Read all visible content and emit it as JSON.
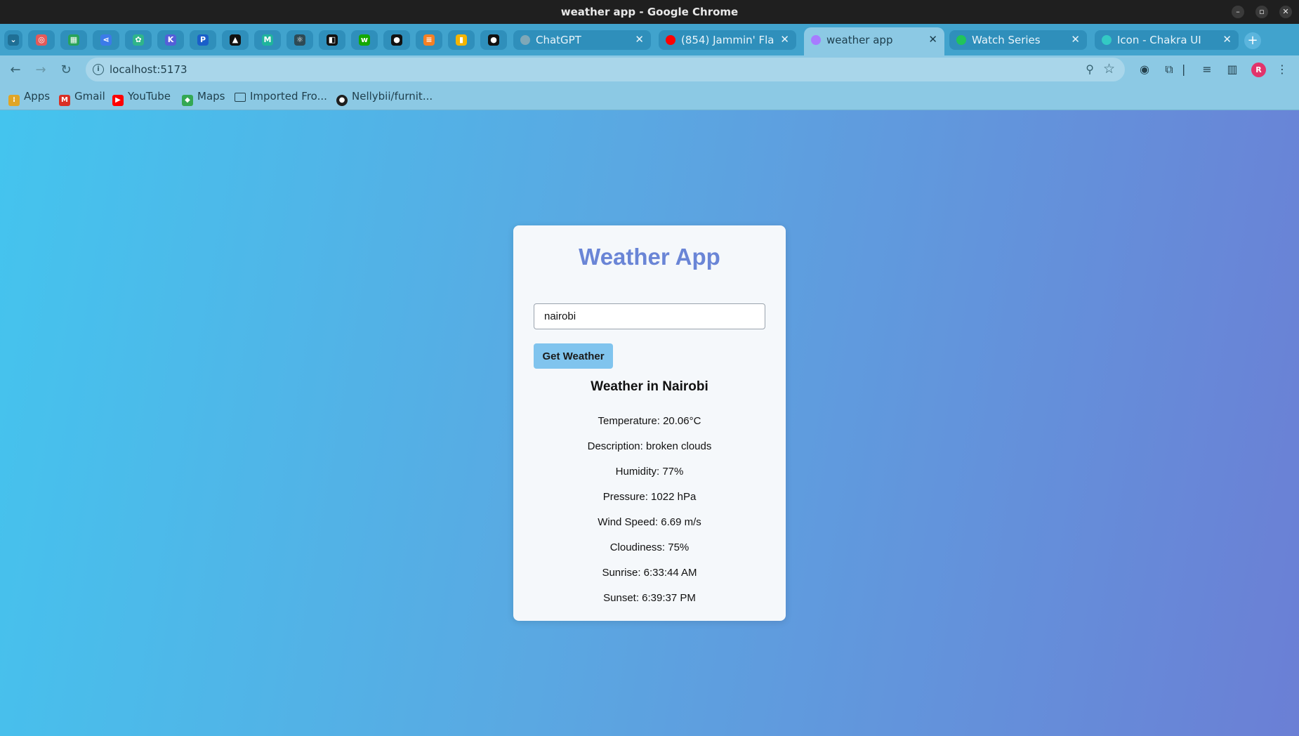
{
  "window": {
    "title": "weather app - Google Chrome"
  },
  "tabs": {
    "pinned": [
      {
        "icon": "opera-gx-icon",
        "color": "#e35a5a"
      },
      {
        "icon": "sheets-icon",
        "color": "#27a35a"
      },
      {
        "icon": "share-icon",
        "color": "#3b7be8"
      },
      {
        "icon": "chatgpt-icon",
        "color": "#2fb58a"
      },
      {
        "icon": "kotlin-icon",
        "color": "#5460d8"
      },
      {
        "icon": "paypal-icon",
        "color": "#1a5fc9"
      },
      {
        "icon": "vercel-icon",
        "color": "#111111"
      },
      {
        "icon": "mui-icon",
        "color": "#1fb59c"
      },
      {
        "icon": "react-icon",
        "color": "#2e4a55"
      },
      {
        "icon": "codesandbox-icon",
        "color": "#111111"
      },
      {
        "icon": "upwork-icon",
        "color": "#14a800"
      },
      {
        "icon": "github-icon",
        "color": "#111111"
      },
      {
        "icon": "stackoverflow-icon",
        "color": "#f48024"
      },
      {
        "icon": "analytics-icon",
        "color": "#f4b400"
      },
      {
        "icon": "github-icon",
        "color": "#111111"
      }
    ],
    "open": [
      {
        "label": "ChatGPT",
        "favicon": "chatgpt-icon",
        "color": "#7fa8b8"
      },
      {
        "label": "(854) Jammin' Fla",
        "favicon": "youtube-icon",
        "color": "#ff0000"
      },
      {
        "label": "weather app",
        "favicon": "vite-icon",
        "color": "#a77bff",
        "active": true
      },
      {
        "label": "Watch Series",
        "favicon": "play-icon",
        "color": "#21c45a"
      },
      {
        "label": "Icon - Chakra UI",
        "favicon": "chakra-icon",
        "color": "#33c9c4"
      }
    ],
    "close_glyph": "✕",
    "new_tab_glyph": "+"
  },
  "toolbar": {
    "url": "localhost:5173",
    "back_glyph": "←",
    "forward_glyph": "→",
    "reload_glyph": "↻"
  },
  "bookmarks": [
    {
      "label": "Apps",
      "icon": "apps-grid-icon"
    },
    {
      "label": "Gmail",
      "icon": "gmail-icon"
    },
    {
      "label": "YouTube",
      "icon": "youtube-icon"
    },
    {
      "label": "Maps",
      "icon": "maps-icon"
    },
    {
      "label": "Imported Fro...",
      "icon": "folder-icon"
    },
    {
      "label": "Nellybii/furnit...",
      "icon": "github-icon"
    }
  ],
  "app": {
    "title": "Weather App",
    "input_value": "nairobi",
    "button_label": "Get Weather",
    "heading": "Weather in Nairobi",
    "details": [
      "Temperature: 20.06°C",
      "Description: broken clouds",
      "Humidity: 77%",
      "Pressure: 1022 hPa",
      "Wind Speed: 6.69 m/s",
      "Cloudiness: 75%",
      "Sunrise: 6:33:44 AM",
      "Sunset: 6:39:37 PM"
    ]
  },
  "profile_initial": "R"
}
